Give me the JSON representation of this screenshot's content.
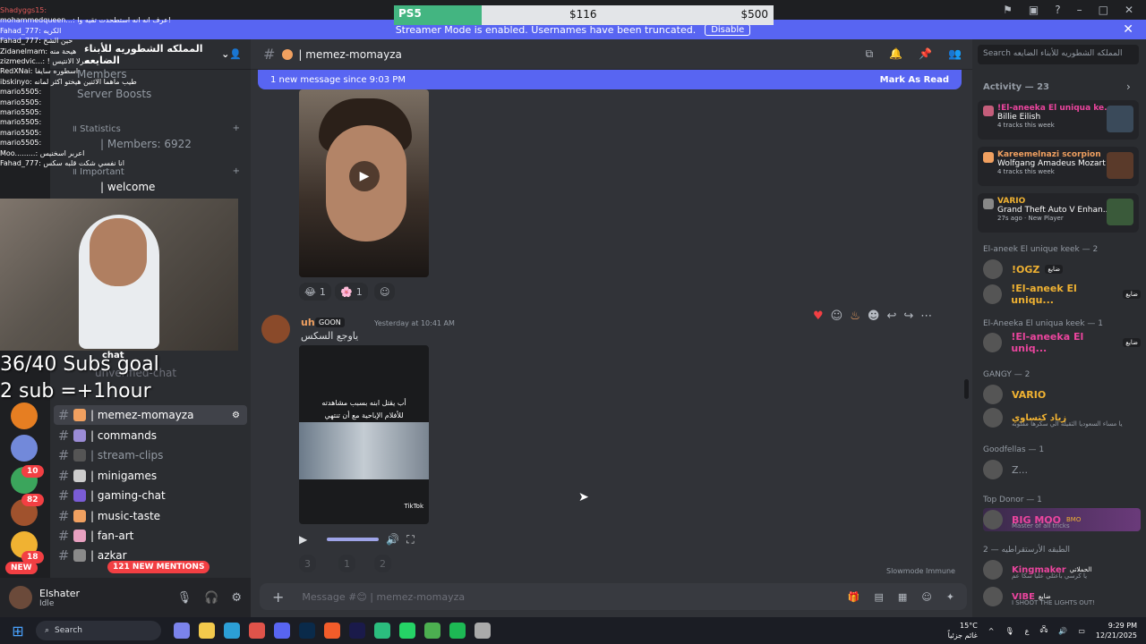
{
  "streamer": {
    "banner": "Streamer Mode is enabled. Usernames have been truncated.",
    "disable": "Disable"
  },
  "ps5": {
    "label": "PS5",
    "current": "$116",
    "target": "$500"
  },
  "server": {
    "name": "المملكه الشطوريه للأبناء الضايعه"
  },
  "sidebar_top": [
    {
      "label": "Members"
    },
    {
      "label": "Server Boosts"
    },
    {
      "label": "॥ Statistics"
    },
    {
      "label": "| Members: 6922"
    },
    {
      "label": "॥ Important"
    },
    {
      "label": "| welcome"
    }
  ],
  "channels": [
    {
      "label": "unverified-chat"
    },
    {
      "label": "| memez-momayza"
    },
    {
      "label": "| commands"
    },
    {
      "label": "| stream-clips"
    },
    {
      "label": "| minigames"
    },
    {
      "label": "| gaming-chat"
    },
    {
      "label": "| music-taste"
    },
    {
      "label": "| fan-art"
    },
    {
      "label": "| azkar"
    }
  ],
  "badges": {
    "new": "NEW",
    "mentions": "121 NEW MENTIONS",
    "b10": "10",
    "b82": "82",
    "b18": "18"
  },
  "overlay": {
    "goal": "36/40 Subs goal",
    "rate": "2 sub =+1hour",
    "chat_label": "chat",
    "lines": [
      "Shadyggs15: ",
      "mohammedqueen...: عرف انه انه استطحدت تقيه وا!",
      "Fahad_777: الكريه",
      "Fahad_777: حين الشخ",
      "Zidanelmam: هيحة منه",
      "zizmedvic...: ! حرلا الانتيس",
      "RedXNai: اسطوره سايفا",
      "ibskinyo: طيب ماهما الاثنين هيختو اكثر لمانه",
      "mario5505: ",
      "mario5505: ",
      "mario5505: ",
      "mario5505: ",
      "mario5505: ",
      "mario5505: ",
      "Moo.........: اعربر اسخنيس",
      "Fahad_777: انا نفسي شكت قلبه سكس"
    ]
  },
  "user": {
    "name": "Elshater",
    "status": "Idle"
  },
  "channel": {
    "name": "| memez-momayza",
    "hash": "#"
  },
  "newbar": {
    "text": "1 new message since 9:03 PM",
    "action": "Mark As Read"
  },
  "reactions1": [
    {
      "emoji": "😂",
      "count": "1"
    },
    {
      "emoji": "🌸",
      "count": "1"
    }
  ],
  "reactions2": [
    {
      "count": "3"
    },
    {
      "count": "1"
    },
    {
      "count": "2"
    }
  ],
  "message": {
    "user": "uh",
    "tag": "GOON",
    "time": "Yesterday at 10:41 AM",
    "text": "ياوجع السكس",
    "caption1": "أب يقتل ابنه بسبب مشاهدته",
    "caption2": "للأفلام الإباحية مع أن تنتهي",
    "tiktok": "TikTok"
  },
  "composer": {
    "placeholder": "Message #😊 | memez-momayza"
  },
  "slowmode": "Slowmode Immune",
  "search": {
    "placeholder": "Search المملكه الشطوريه للأبناء الضايعه"
  },
  "activity": {
    "header": "Activity — 23",
    "cards": [
      {
        "user": "!El-aneeka El uniqua ke...",
        "title": "Billie Eilish",
        "sub": "4 tracks this week"
      },
      {
        "user": "Kareemelnazi scorpion",
        "title": "Wolfgang Amadeus Mozart",
        "sub": "4 tracks this week"
      },
      {
        "user": "VARIO",
        "title": "Grand Theft Auto V Enhan...",
        "sub": "27s ago · New Player"
      }
    ]
  },
  "members": [
    {
      "section": "El-aneek El unique keek — 2"
    },
    {
      "name": "!OGZ",
      "role": "ضايع",
      "color": "#f0b232"
    },
    {
      "name": "!El-aneek El uniqu...",
      "role": "ضايع",
      "color": "#f0b232"
    },
    {
      "section": "El-Aneeka El uniqua keek — 1"
    },
    {
      "name": "!El-aneeka El uniq...",
      "role": "ضايع",
      "color": "#eb459e"
    },
    {
      "section": "GANGY — 2"
    },
    {
      "name": "VARIO",
      "color": "#f0b232"
    },
    {
      "name": "زياد كتساوي",
      "sub": "يا مساء السعوديا الثقيله الي سكرها مقلوبه",
      "color": "#f0b232"
    },
    {
      "section": "Goodfellas — 1"
    },
    {
      "name": "Z...",
      "color": "#949ba4"
    },
    {
      "section": "Top Donor — 1"
    },
    {
      "name": "BIG MOO",
      "tag": "BMO",
      "sub": "Master of all tricks",
      "color": "#eb459e"
    },
    {
      "section": "الطبقه الأرستقراطيه — 2"
    },
    {
      "name": "Kingmaker",
      "role": "الحملاتي",
      "sub": "يا كرسي باعثلي عليا سكا عم",
      "color": "#eb459e"
    },
    {
      "name": "VIBE",
      "role": "ضايع",
      "sub": "I SHOOT THE LIGHTS OUT!",
      "color": "#eb459e"
    }
  ],
  "taskbar": {
    "search": "Search",
    "weather": "15°C",
    "weather_sub": "غائم جزئياً",
    "time": "9:29 PM",
    "date": "12/21/2025",
    "lang": "ع"
  }
}
